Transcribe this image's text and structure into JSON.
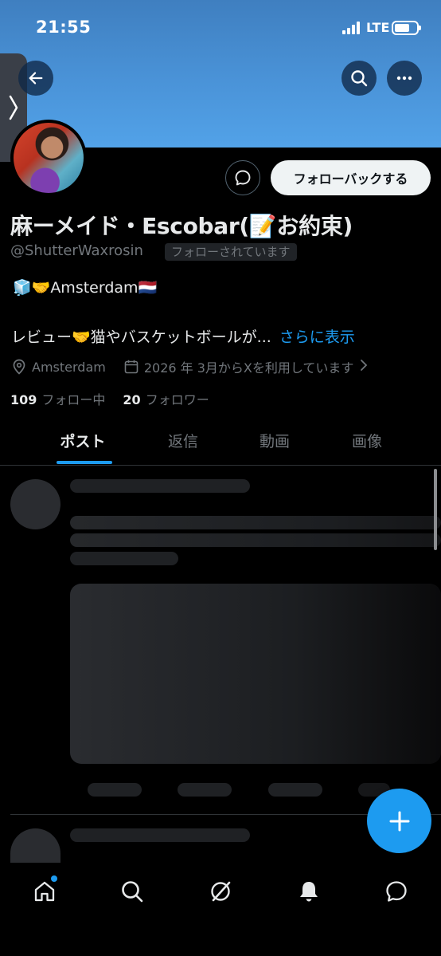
{
  "status_bar": {
    "time": "21:55",
    "network": "LTE"
  },
  "profile": {
    "display_name": "麻ーメイド・Escobar(📝お約束)",
    "handle": "@ShutterWaxrosin",
    "follows_you_badge": "フォローされています",
    "bio_line1": "🧊🤝Amsterdam🇳🇱",
    "bio_line2": "レビュー🤝猫やバスケットボールが...",
    "show_more": "さらに表示",
    "location": "Amsterdam",
    "joined": "2026 年 3月からXを利用しています",
    "following_count": "109",
    "following_label": "フォロー中",
    "followers_count": "20",
    "followers_label": "フォロワー"
  },
  "actions": {
    "follow_back": "フォローバックする"
  },
  "tabs": [
    {
      "label": "ポスト",
      "active": true
    },
    {
      "label": "返信",
      "active": false
    },
    {
      "label": "動画",
      "active": false
    },
    {
      "label": "画像",
      "active": false
    }
  ],
  "colors": {
    "accent": "#1d9bf0",
    "background": "#000000",
    "banner": "#4a93d8"
  },
  "icons": {
    "back": "back-arrow-icon",
    "search": "search-icon",
    "more": "more-icon",
    "message": "message-icon",
    "location": "location-pin-icon",
    "calendar": "calendar-icon",
    "compose": "plus-icon",
    "nav": [
      "home-icon",
      "search-icon",
      "grok-icon",
      "bell-icon",
      "chat-icon"
    ]
  }
}
